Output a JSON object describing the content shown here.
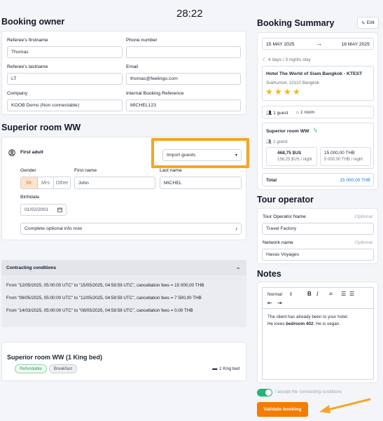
{
  "timer": "28:22",
  "booking_owner": {
    "title": "Booking owner",
    "firstname_label": "Referee's firstname",
    "firstname_value": "Thomas",
    "phone_label": "Phone number",
    "phone_value": "",
    "lastname_label": "Referee's lastname",
    "lastname_value": "LT",
    "email_label": "Email",
    "email_value": "thomas@feelingo.com",
    "company_label": "Company",
    "company_value": "KOOB Demo (Non connectable)",
    "ref_label": "Internal Booking Reference",
    "ref_value": "MICHEL123"
  },
  "room": {
    "title": "Superior room WW",
    "adult_label": "First adult",
    "import_guests": "Import guests",
    "gender_label": "Gender",
    "genders": [
      "Mr",
      "Mrs",
      "Other"
    ],
    "firstname_label": "First name",
    "firstname_value": "John",
    "lastname_label": "Last name",
    "lastname_value": "MICHEL",
    "birthdate_label": "Birthdate",
    "birthdate_value": "01/02/2001",
    "optional_info": "Complete optional info now"
  },
  "contracting": {
    "title": "Contracting conditions",
    "lines": [
      "From \"12/05/2025, 05:00:00 UTC\" to \"15/05/2025, 04:59:59 UTC\", cancellation fees = 15 000,00 THB",
      "From \"08/05/2025, 05:00:00 UTC\" to \"12/05/2025, 04:59:59 UTC\", cancellation fees = 7 500,00 THB",
      "From \"14/03/2025, 05:00:00 UTC\" to \"08/05/2025, 04:59:59 UTC\", cancellation fees = 0,00 THB"
    ]
  },
  "room_card": {
    "title": "Superior room WW (1 King bed)",
    "tags": [
      "Refundable",
      "Breakfast"
    ],
    "bed": "1 King bed"
  },
  "summary": {
    "title": "Booking Summary",
    "edit": "Edit",
    "date_from": "15 MAY 2025",
    "date_to": "18 MAY 2025",
    "stay": "4 days / 3 nights stay",
    "hotel_name": "Hotel The World of Siam Bangkok - KTEST",
    "hotel_address": "Sukhumvit, 10110 Bangkok",
    "stars": 4,
    "guests": "1 guest",
    "rooms": "1 room",
    "room_name": "Superior room WW",
    "room_guests": "1 guest",
    "price_usd": "468,75 $US",
    "price_usd_night": "156,25 $US / night",
    "price_thb": "15 000,00 THB",
    "price_thb_night": "5 000,00 THB / night",
    "total_label": "Total",
    "total_value": "15 000,00 THB"
  },
  "tour_operator": {
    "title": "Tour operator",
    "name_label": "Tour Operator Name",
    "name_optional": "Optional",
    "name_value": "Travel Factory",
    "network_label": "Network name",
    "network_optional": "Optional",
    "network_value": "Havas Voyages"
  },
  "notes": {
    "title": "Notes",
    "format": "Normal",
    "line1": "The client has already been to your hotel.",
    "line2_prefix": "He loves ",
    "line2_bold": "bedroom 402",
    "line2_suffix": ". He is vegan."
  },
  "accept_label": "I accept the contracting conditions",
  "validate_label": "Validate booking",
  "colors": {
    "accent": "#1a73e8",
    "orange": "#f5a623",
    "validate": "#f57c00",
    "toggle": "#22b573"
  }
}
